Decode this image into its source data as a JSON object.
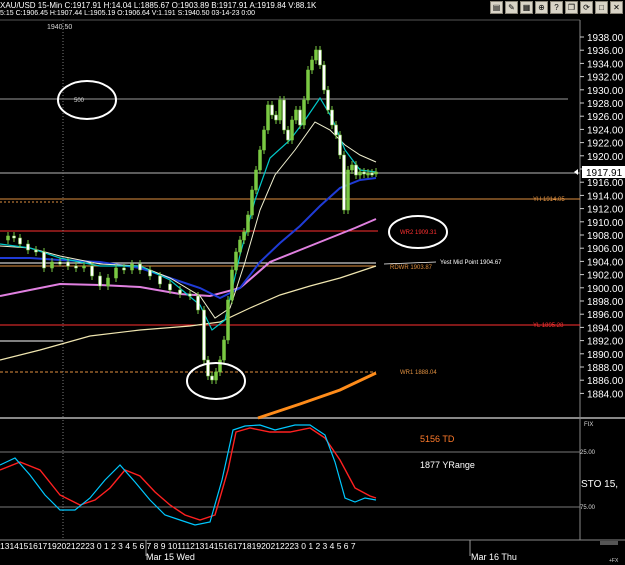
{
  "header": {
    "quote_line": "XAU/USD  15-Min  C:1917.91  H:14.04  L:1885.67  O:1903.89  B:1917.91  A:1919.84  V:88.1K",
    "status_line": "5:15  C:1906.45  H:1907.44  L:1905.19  O:1906.64  V:1.191  S:1940.50  03-14-23  0:00",
    "toolbar_icons": [
      "chart-icon",
      "pencil-icon",
      "grid-icon",
      "zoom-icon",
      "help-icon",
      "window-icon",
      "sync-icon",
      "maximize-icon",
      "close-icon"
    ]
  },
  "price_axis": {
    "labels": [
      "1938.00",
      "1936.00",
      "1934.00",
      "1932.00",
      "1930.00",
      "1928.00",
      "1926.00",
      "1924.00",
      "1922.00",
      "1920.00",
      "1918.00",
      "1916.00",
      "1914.00",
      "1912.00",
      "1910.00",
      "1908.00",
      "1906.00",
      "1904.00",
      "1902.00",
      "1900.00",
      "1898.00",
      "1896.00",
      "1894.00",
      "1892.00",
      "1890.00",
      "1888.00",
      "1886.00",
      "1884.00"
    ],
    "current_price": "1917.91",
    "top_value": "1940.50"
  },
  "annotations": {
    "level_500": "500",
    "yh": "YH  1914.05",
    "wr2": "WR2  1909.31",
    "yest_mid": "Yest Mid Point  1904.67",
    "rdwr": "RDWR  1903.87",
    "yl": "YL  1895.28",
    "wr1": "WR1  1888.04"
  },
  "indicator": {
    "td_label": "5156 TD",
    "yrange_label": "1877 YRange",
    "sto_label": "STO  15,",
    "axis_25": "25.00",
    "axis_75": "75.00",
    "axis_top": "FIX",
    "marker": "+FX"
  },
  "time_axis": {
    "hours_left": "13141516171920212223 0  1  2  3  4  5  6  7  8  9 1011121314151617181920212223 0  1  2  3  4  5  6  7",
    "day1": "Mar 15 Wed",
    "day2": "Mar 16 Thu"
  },
  "colors": {
    "background": "#000000",
    "candle": "#7ac943",
    "ma_fast": "#00c8c8",
    "ma_blue": "#1f3bd6",
    "ma_pink": "#e080e0",
    "ma_cream": "#f0e6b0",
    "ma_orange": "#ff8c1a",
    "yh_line": "#e09040",
    "wr2_line": "#ff3030",
    "sto_fast": "#00c8ff",
    "sto_slow": "#ff2020"
  }
}
